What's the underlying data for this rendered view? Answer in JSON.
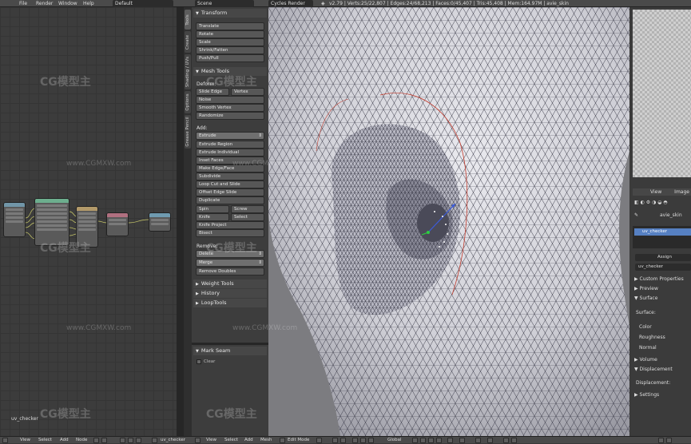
{
  "topbar": {
    "menu": [
      "File",
      "Render",
      "Window",
      "Help"
    ],
    "layout": "Default",
    "scene": "Scene",
    "engine": "Cycles Render",
    "stats": "v2.79 | Verts:25/22,807 | Edges:24/68,213 | Faces:0/45,407 | Tris:45,408 | Mem:164.97M | avie_skin"
  },
  "node_editor": {
    "label": "uv_checker"
  },
  "tool_tabs": [
    "Tools",
    "Create",
    "Shading / UVs",
    "Options",
    "Grease Pencil"
  ],
  "shelf": {
    "transform": {
      "title": "Transform",
      "buttons": [
        "Translate",
        "Rotate",
        "Scale",
        "Shrink/Fatten",
        "Push/Pull"
      ]
    },
    "mesh_tools": {
      "title": "Mesh Tools",
      "deform_label": "Deform:",
      "deform": [
        "Slide Edge",
        "Vertex",
        "Noise",
        "Smooth Vertex",
        "Randomize"
      ],
      "add_label": "Add:",
      "extrude": "Extrude",
      "add": [
        "Extrude Region",
        "Extrude Individual",
        "Inset Faces",
        "Make Edge/Face",
        "Subdivide",
        "Loop Cut and Slide",
        "Offset Edge Slide",
        "Duplicate"
      ],
      "spin": "Spin",
      "screw": "Screw",
      "knife": "Knife",
      "select": "Select",
      "add2": [
        "Knife Project",
        "Bisect"
      ],
      "remove_label": "Remove:",
      "delete": "Delete",
      "merge": "Merge",
      "remove_doubles": "Remove Doubles"
    },
    "collapsed": [
      "Weight Tools",
      "History",
      "LoopTools"
    ],
    "mark_seam": {
      "title": "Mark Seam",
      "clear": "Clear"
    }
  },
  "right_panel": {
    "view": "View",
    "image": "Image",
    "object": "avie_skin",
    "material": "uv_checker",
    "assign": "Assign",
    "material_field": "uv_checker",
    "sections": [
      "Custom Properties",
      "Preview",
      "Surface"
    ],
    "surface_label": "Surface:",
    "props": [
      "Color",
      "Roughness",
      "Normal"
    ],
    "volume": "Volume",
    "displacement": "Displacement",
    "displacement_label": "Displacement:",
    "settings": "Settings"
  },
  "bottombar": {
    "left": [
      "View",
      "Select",
      "Add",
      "Node",
      "uv_checker"
    ],
    "right": [
      "View",
      "Select",
      "Add",
      "Mesh",
      "Edit Mode",
      "Global"
    ]
  },
  "watermark": {
    "text": "CG模型主",
    "url": "www.CGMXW.com"
  },
  "colors": {
    "selection": "#5680c2",
    "vertex_selected": "#ffffff",
    "seam": "#c0392b",
    "gizmo_y": "#2ecc40",
    "gizmo_z": "#3b5bdb"
  }
}
